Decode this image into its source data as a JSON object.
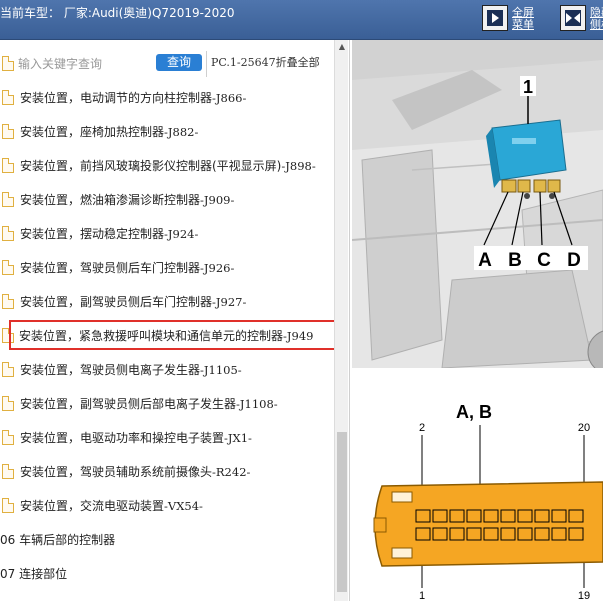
{
  "header": {
    "title": "当前车型：  厂家:Audi(奥迪)Q72019-2020",
    "fullscreen_label": "全屏",
    "menu_label": "菜单",
    "collapse_label": "隐藏",
    "side_label": "侧栏"
  },
  "search": {
    "placeholder": "输入关键字查询",
    "button_label": "查询",
    "pc_text": "PC.1-25647折叠全部"
  },
  "tree": {
    "items": [
      {
        "label": "安装位置，电动调节的方向柱控制器",
        "code": "-J866-"
      },
      {
        "label": "安装位置，座椅加热控制器",
        "code": "-J882-"
      },
      {
        "label": "安装位置，前挡风玻璃投影仪控制器(平视显示屏)",
        "code": "-J898-"
      },
      {
        "label": "安装位置，燃油箱渗漏诊断控制器",
        "code": "-J909-"
      },
      {
        "label": "安装位置，摆动稳定控制器",
        "code": "-J924-"
      },
      {
        "label": "安装位置，驾驶员侧后车门控制器",
        "code": "-J926-"
      },
      {
        "label": "安装位置，副驾驶员侧后车门控制器",
        "code": "-J927-"
      },
      {
        "label": "安装位置，紧急救援呼叫模块和通信单元的控制器",
        "code": "-J949"
      },
      {
        "label": "安装位置，驾驶员侧电离子发生器",
        "code": "-J1105-"
      },
      {
        "label": "安装位置，副驾驶员侧后部电离子发生器",
        "code": "-J1108-"
      },
      {
        "label": "安装位置，电驱动功率和操控电子装置",
        "code": "-JX1-"
      },
      {
        "label": "安装位置，驾驶员辅助系统前摄像头",
        "code": "-R242-"
      },
      {
        "label": "安装位置，交流电驱动装置",
        "code": "-VX54-"
      }
    ],
    "categories": [
      {
        "label": "06 车辆后部的控制器"
      },
      {
        "label": "07 连接部位"
      }
    ]
  },
  "diagram": {
    "top_number": "1",
    "connector_labels": [
      "A",
      "B",
      "C",
      "D"
    ],
    "pinout_title": "A, B",
    "pin_top_left": "2",
    "pin_top_right": "20",
    "pin_bottom_left": "1",
    "pin_bottom_right": "19"
  },
  "colors": {
    "header_bg": "#3a5f96",
    "query_button": "#2a7fd4",
    "highlight_border": "#e0302a",
    "module_blue": "#2aa7d6",
    "connector_orange": "#f5a623"
  }
}
